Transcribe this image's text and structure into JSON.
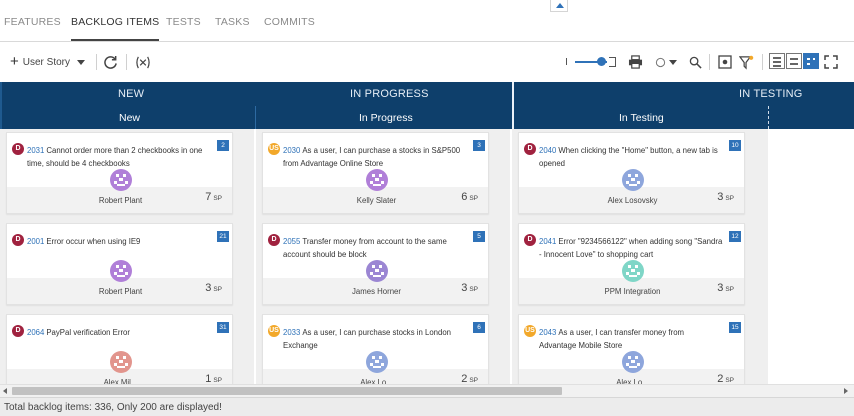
{
  "tabs": [
    {
      "label": "FEATURES",
      "active": false
    },
    {
      "label": "BACKLOG ITEMS",
      "active": true
    },
    {
      "label": "TESTS",
      "active": false
    },
    {
      "label": "TASKS",
      "active": false
    },
    {
      "label": "COMMITS",
      "active": false
    }
  ],
  "toolbar": {
    "add_label": "User Story",
    "icons": [
      "plus-icon",
      "refresh-icon",
      "group-icon",
      "zoom-slider",
      "print-icon",
      "filter-circle-icon",
      "search-icon",
      "settings-icon",
      "filter-icon",
      "list-view-icon",
      "board-view-icon",
      "grid-view-icon",
      "fullscreen-icon"
    ]
  },
  "board": {
    "groups": [
      "NEW",
      "IN PROGRESS",
      "IN TESTING"
    ],
    "columns": [
      "New",
      "In Progress",
      "In Testing"
    ]
  },
  "cards": [
    {
      "type": "D",
      "id": "2031",
      "title": "Cannot order more than 2 checkbooks in one time, should be 4 checkbooks",
      "rank": "2",
      "owner": "Robert Plant",
      "points": "7",
      "unit": "SP",
      "avatar_color": "#b07fd8"
    },
    {
      "type": "D",
      "id": "2001",
      "title": "Error occur when using IE9",
      "rank": "21",
      "owner": "Robert Plant",
      "points": "3",
      "unit": "SP",
      "avatar_color": "#b07fd8"
    },
    {
      "type": "D",
      "id": "2064",
      "title": "PayPal verification Error",
      "rank": "31",
      "owner": "Alex Mil...",
      "points": "1",
      "unit": "SP",
      "avatar_color": "#e2958d"
    },
    {
      "type": "US",
      "id": "2030",
      "title": "As a user, I can purchase a stocks in S&P500 from Advantage Online Store",
      "rank": "3",
      "owner": "Kelly Slater",
      "points": "6",
      "unit": "SP",
      "avatar_color": "#b07fd8"
    },
    {
      "type": "D",
      "id": "2055",
      "title": "Transfer money from account to the same account should be block",
      "rank": "5",
      "owner": "James Horner",
      "points": "3",
      "unit": "SP",
      "avatar_color": "#9b86d3"
    },
    {
      "type": "US",
      "id": "2033",
      "title": "As a user, I can purchase stocks in London Exchange",
      "rank": "6",
      "owner": "Alex Lo...",
      "points": "2",
      "unit": "SP",
      "avatar_color": "#8ea6dc"
    },
    {
      "type": "D",
      "id": "2040",
      "title": "When clicking the \"Home\" button, a new tab is opened",
      "rank": "10",
      "owner": "Alex Losovsky",
      "points": "3",
      "unit": "SP",
      "avatar_color": "#8ea6dc"
    },
    {
      "type": "D",
      "id": "2041",
      "title": "Error \"9234566122\" when adding song \"Sandra - Innocent Love\" to shopping cart",
      "rank": "12",
      "owner": "PPM Integration",
      "points": "3",
      "unit": "SP",
      "avatar_color": "#7fd6c7"
    },
    {
      "type": "US",
      "id": "2043",
      "title": "As a user, I can transfer money from Advantage Mobile Store",
      "rank": "15",
      "owner": "Alex Lo...",
      "points": "2",
      "unit": "SP",
      "avatar_color": "#8ea6dc"
    }
  ],
  "status": {
    "text": "Total backlog items: 336, Only 200 are displayed!"
  }
}
